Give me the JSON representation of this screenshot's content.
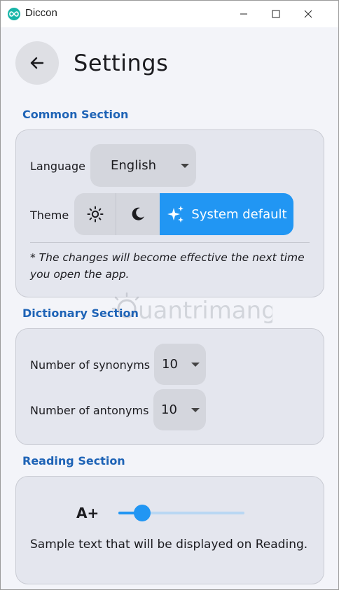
{
  "window": {
    "title": "Diccon"
  },
  "header": {
    "title": "Settings"
  },
  "common": {
    "section_title": "Common Section",
    "language_label": "Language",
    "language_value": "English",
    "theme_label": "Theme",
    "theme_options": [
      "light",
      "dark",
      "System default"
    ],
    "theme_selected": "System default",
    "note": "* The changes will become effective the next time you open the app."
  },
  "dictionary": {
    "section_title": "Dictionary Section",
    "synonyms_label": "Number of synonyms",
    "synonyms_value": "10",
    "antonyms_label": "Number of antonyms",
    "antonyms_value": "10"
  },
  "reading": {
    "section_title": "Reading Section",
    "font_size_icon": "A+",
    "font_size_level": 0.14,
    "sample_text": "Sample text that will be displayed on Reading."
  },
  "watermark": {
    "text": "uantrimang"
  },
  "colors": {
    "accent": "#2196f3",
    "section_title": "#1e63b6",
    "card_bg": "#e4e6ee",
    "page_bg": "#f3f4f9"
  }
}
